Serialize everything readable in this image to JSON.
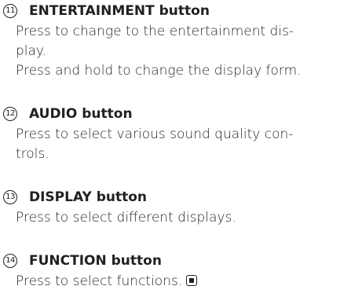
{
  "entries": [
    {
      "number": "11",
      "title": "ENTERTAINMENT button",
      "lines": [
        "Press to change to the entertainment dis-",
        "play.",
        "Press and hold to change the display form."
      ]
    },
    {
      "number": "12",
      "title": "AUDIO button",
      "lines": [
        "Press to select various sound quality con-",
        "trols."
      ]
    },
    {
      "number": "13",
      "title": "DISPLAY button",
      "lines": [
        "Press to select different displays."
      ]
    },
    {
      "number": "14",
      "title": "FUNCTION button",
      "lines": [
        "Press to select functions."
      ],
      "end_icon": "end-of-section-icon"
    }
  ]
}
